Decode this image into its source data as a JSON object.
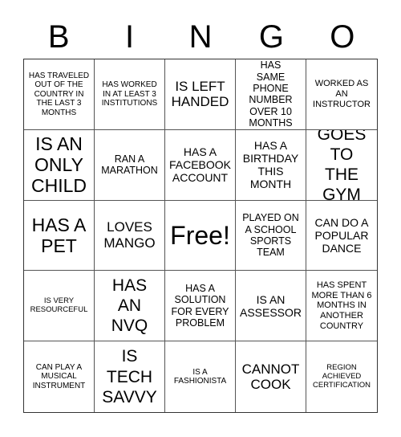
{
  "header": {
    "letters": [
      "B",
      "I",
      "N",
      "G",
      "O"
    ]
  },
  "cells": [
    "HAS TRAVELED OUT OF THE COUNTRY IN THE LAST 3 MONTHS",
    "HAS WORKED IN AT LEAST 3 INSTITUTIONS",
    "IS LEFT HANDED",
    "HAS SAME PHONE NUMBER OVER 10 MONTHS",
    "WORKED AS AN INSTRUCTOR",
    "IS AN ONLY CHILD",
    "RAN A MARATHON",
    "HAS A FACEBOOK ACCOUNT",
    "HAS A BIRTHDAY THIS MONTH",
    "GOES TO THE GYM",
    "HAS A PET",
    "LOVES MANGO",
    "Free!",
    "PLAYED ON A SCHOOL SPORTS TEAM",
    "CAN DO A POPULAR DANCE",
    "IS VERY RESOURCEFUL",
    "HAS AN NVQ",
    "HAS A SOLUTION FOR EVERY PROBLEM",
    "IS AN ASSESSOR",
    "HAS SPENT MORE THAN 6 MONTHS IN ANOTHER COUNTRY",
    "CAN PLAY A MUSICAL INSTRUMENT",
    "IS TECH SAVVY",
    "IS A FASHIONISTA",
    "CANNOT COOK",
    "REGION ACHIEVED CERTIFICATION"
  ]
}
